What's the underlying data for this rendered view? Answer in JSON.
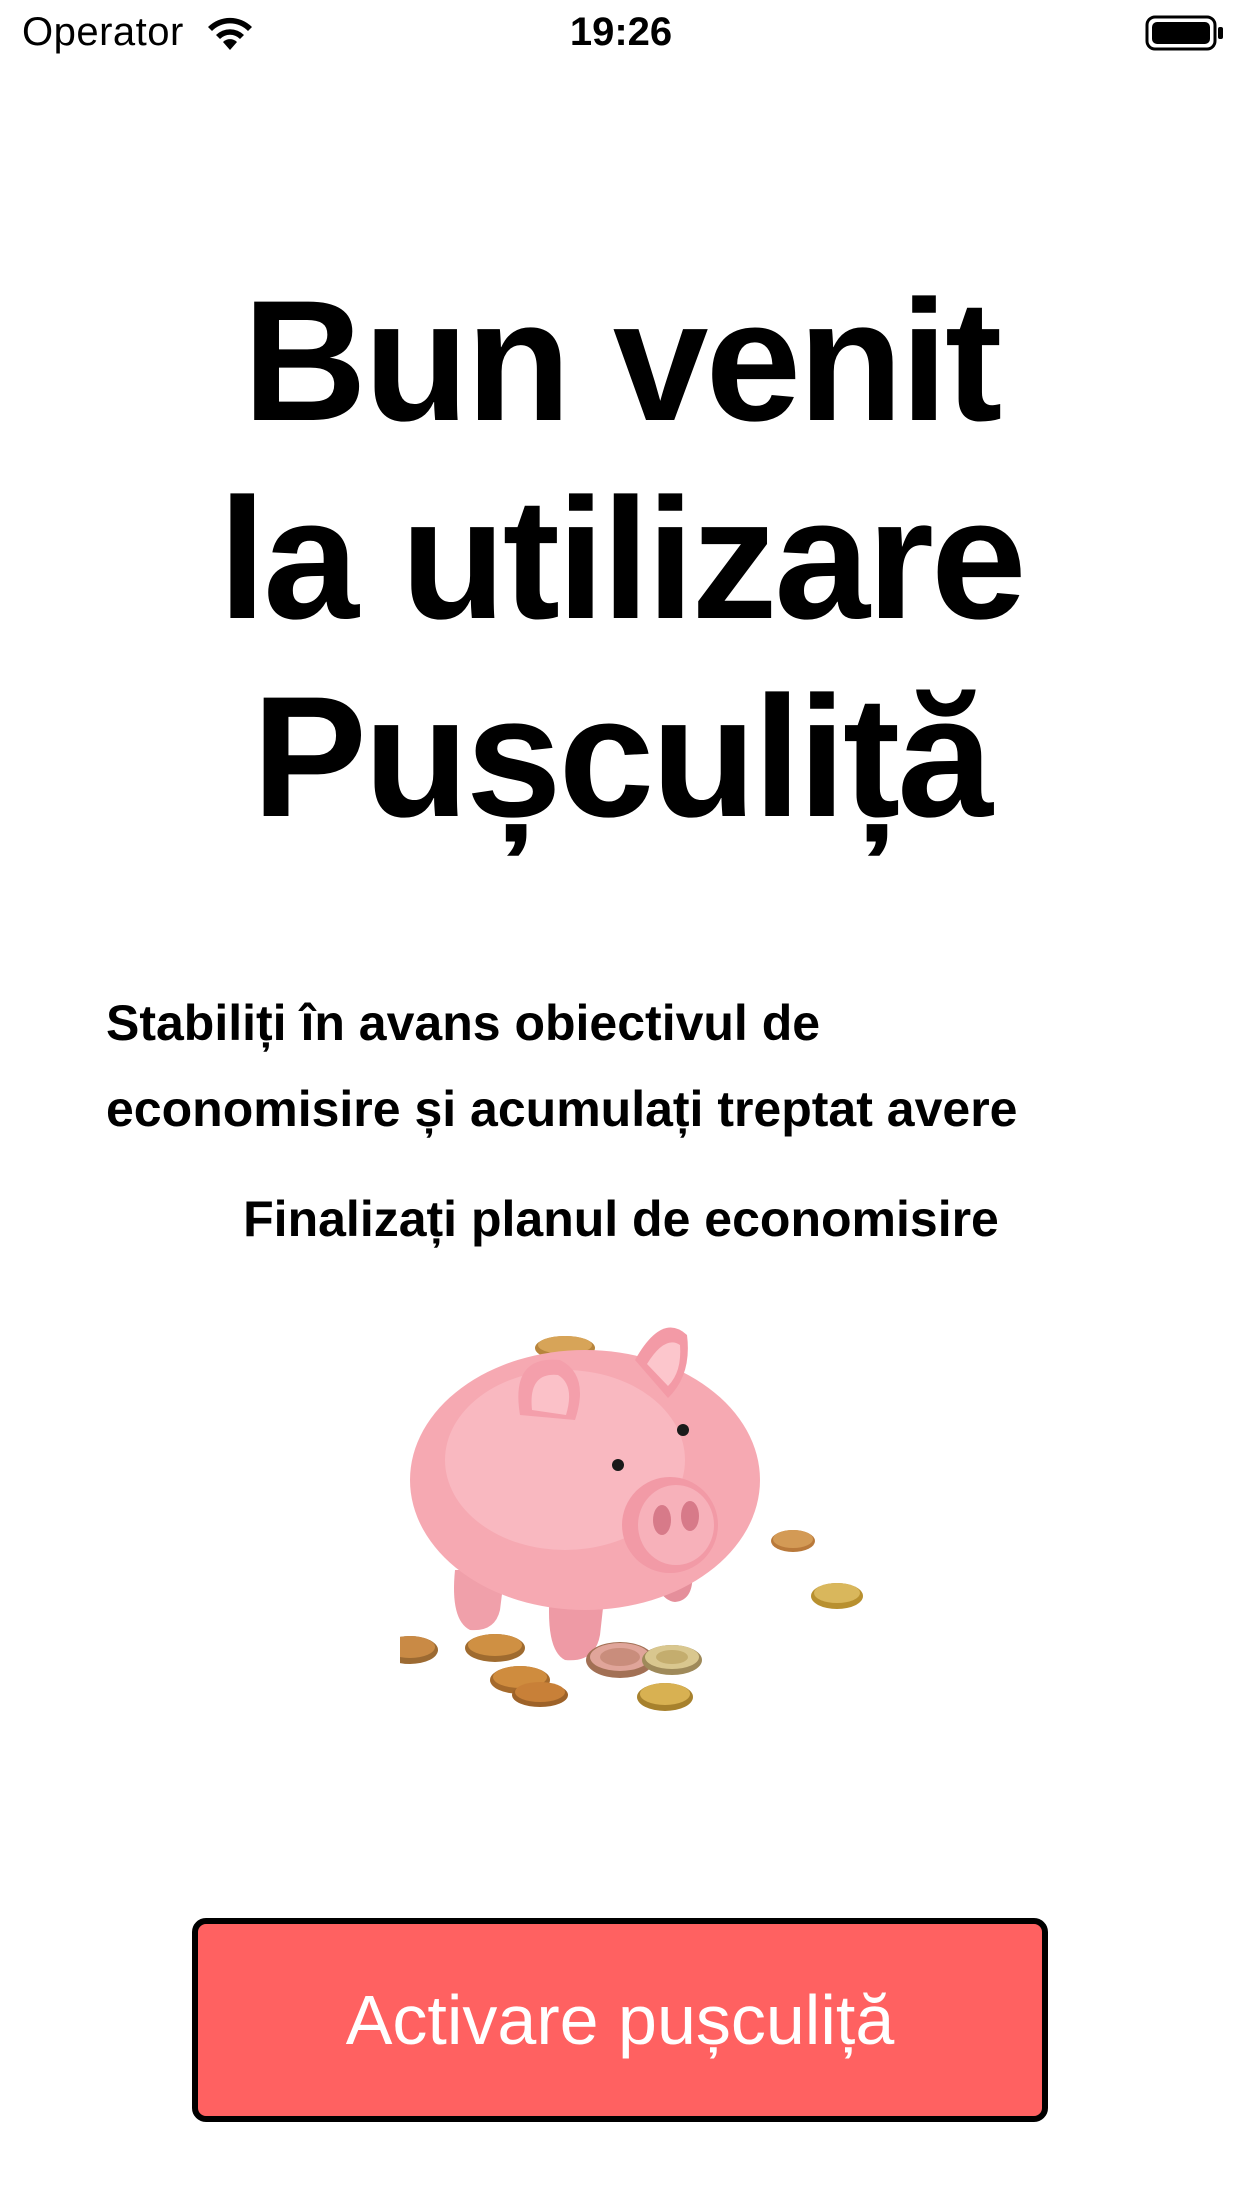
{
  "status_bar": {
    "carrier": "Operator",
    "time": "19:26",
    "wifi_icon": "wifi-icon",
    "battery_icon": "battery-icon"
  },
  "title": {
    "line1": "Bun venit",
    "line2": "la utilizare",
    "line3": "Pușculiță"
  },
  "subtitle": {
    "line1": "Stabiliți în avans obiectivul de",
    "line2": "economisire și acumulați treptat avere"
  },
  "finalize_text": "Finalizați planul de economisire",
  "illustration": {
    "icon": "piggy-bank-with-coins",
    "colors": {
      "pig": "#f4a4ad",
      "coin": "#c98a3e"
    }
  },
  "button": {
    "label": "Activare pușculiță",
    "color": "#ff6161"
  }
}
